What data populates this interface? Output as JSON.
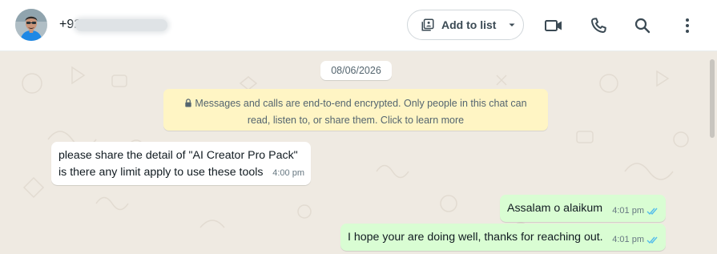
{
  "header": {
    "contact_number": "+92",
    "add_to_list_label": "Add to list"
  },
  "chat": {
    "date": "08/06/2026",
    "encryption_notice_line1": "Messages and calls are end-to-end encrypted. Only people in this chat can",
    "encryption_notice_line2": "read, listen to, or share them. Click to learn more",
    "messages": [
      {
        "direction": "incoming",
        "line1": "please share the detail of \"AI Creator Pro Pack\"",
        "line2": "is there any limit apply to use these tools",
        "time": "4:00 pm"
      },
      {
        "direction": "outgoing",
        "text": "Assalam o alaikum",
        "time": "4:01 pm",
        "status": "read"
      },
      {
        "direction": "outgoing",
        "text": "I hope your are doing well, thanks for reaching out.",
        "time": "4:01 pm",
        "status": "read"
      }
    ]
  },
  "colors": {
    "chat_background": "#efeae2",
    "outgoing_bubble": "#d9fdd3",
    "incoming_bubble": "#ffffff",
    "encryption_notice": "#fff5c4",
    "read_ticks": "#53bdeb"
  },
  "icons": [
    "avatar",
    "add-to-list-icon",
    "dropdown-caret-icon",
    "video-call-icon",
    "voice-call-icon",
    "search-icon",
    "menu-icon",
    "lock-icon",
    "double-check-icon"
  ]
}
